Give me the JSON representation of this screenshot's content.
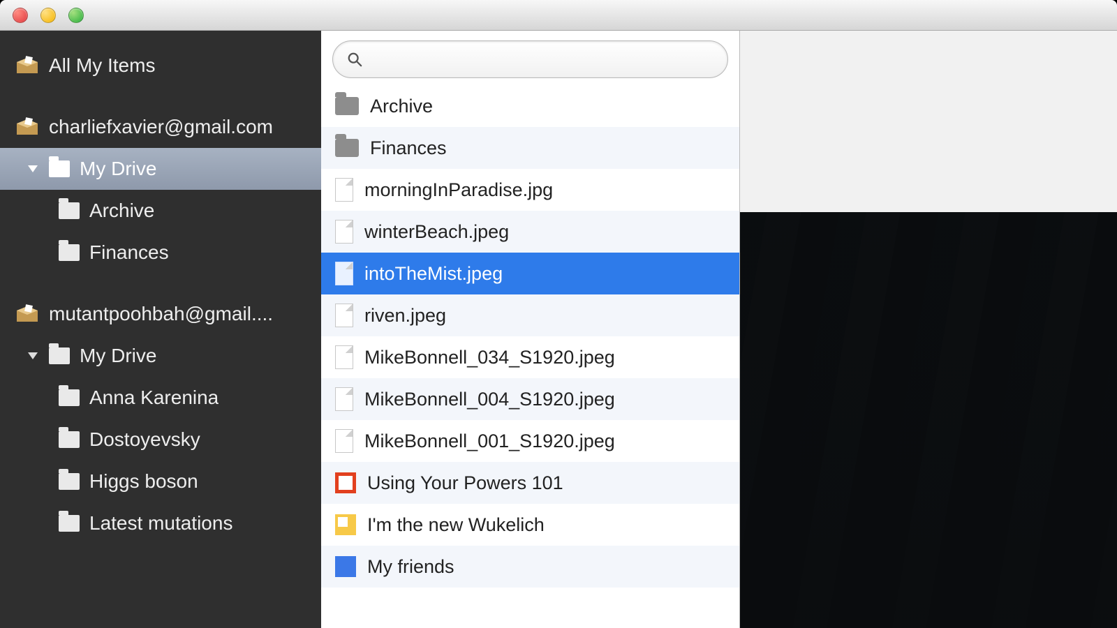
{
  "sidebar": {
    "all_items": "All My Items",
    "accounts": [
      {
        "email": "charliefxavier@gmail.com",
        "drive_label": "My Drive",
        "selected": true,
        "folders": [
          "Archive",
          "Finances"
        ]
      },
      {
        "email": "mutantpoohbah@gmail....",
        "drive_label": "My Drive",
        "selected": false,
        "folders": [
          "Anna Karenina",
          "Dostoyevsky",
          "Higgs boson",
          "Latest mutations"
        ]
      }
    ]
  },
  "search": {
    "placeholder": ""
  },
  "files": [
    {
      "name": "Archive",
      "kind": "folder"
    },
    {
      "name": "Finances",
      "kind": "folder"
    },
    {
      "name": "morningInParadise.jpg",
      "kind": "file"
    },
    {
      "name": "winterBeach.jpeg",
      "kind": "file"
    },
    {
      "name": "intoTheMist.jpeg",
      "kind": "file",
      "selected": true
    },
    {
      "name": "riven.jpeg",
      "kind": "file"
    },
    {
      "name": "MikeBonnell_034_S1920.jpeg",
      "kind": "file"
    },
    {
      "name": "MikeBonnell_004_S1920.jpeg",
      "kind": "file"
    },
    {
      "name": "MikeBonnell_001_S1920.jpeg",
      "kind": "file"
    },
    {
      "name": "Using Your Powers 101",
      "kind": "gslides"
    },
    {
      "name": "I'm the new Wukelich",
      "kind": "gdraw"
    },
    {
      "name": "My friends",
      "kind": "gdoc"
    }
  ]
}
